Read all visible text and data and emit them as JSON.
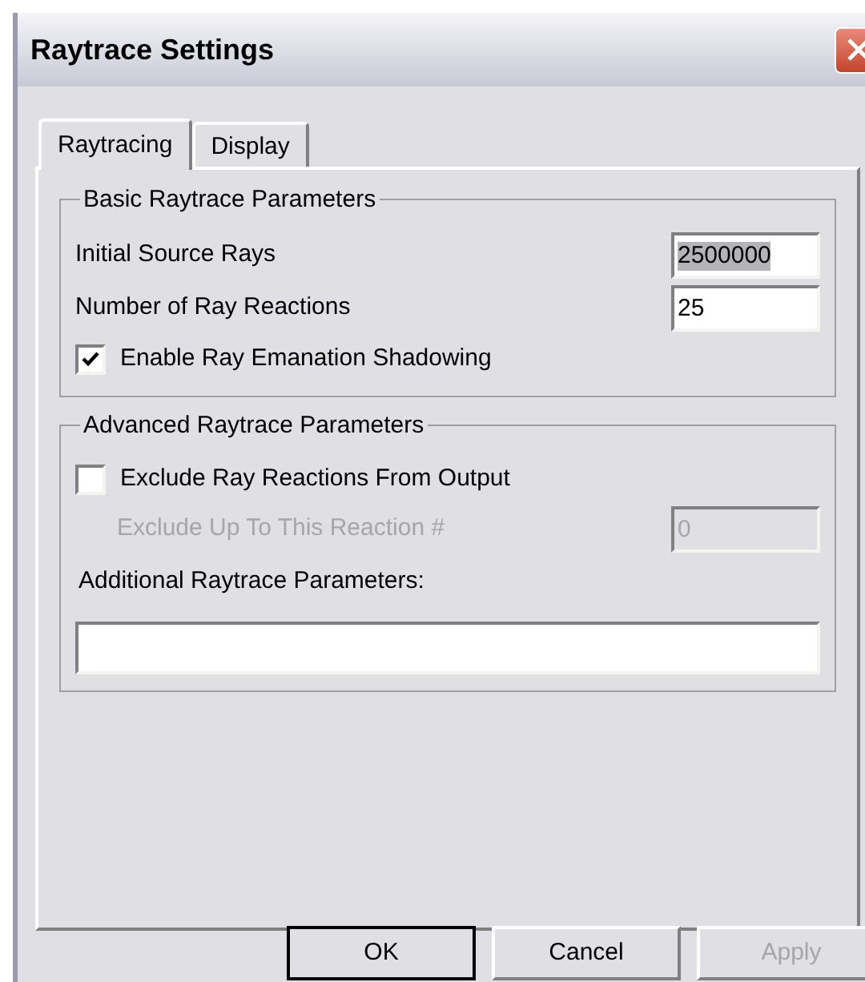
{
  "window": {
    "title": "Raytrace Settings"
  },
  "tabs": [
    {
      "label": "Raytracing",
      "selected": true
    },
    {
      "label": "Display",
      "selected": false
    }
  ],
  "groups": [
    {
      "title": "Basic Raytrace Parameters",
      "rows": [
        {
          "kind": "number",
          "label": "Initial Source Rays",
          "value": "2500000",
          "highlighted": true,
          "disabled": false
        },
        {
          "kind": "number",
          "label": "Number of Ray Reactions",
          "value": "25",
          "highlighted": false,
          "disabled": false
        },
        {
          "kind": "checkbox",
          "label": "Enable Ray Emanation Shadowing",
          "checked": true
        }
      ]
    },
    {
      "title": "Advanced Raytrace Parameters",
      "rows": [
        {
          "kind": "checkbox",
          "label": "Exclude Ray Reactions From Output",
          "checked": false
        },
        {
          "kind": "number",
          "label": "Exclude Up To This Reaction #",
          "value": "0",
          "highlighted": false,
          "disabled": true
        },
        {
          "kind": "text",
          "label": "Additional Raytrace Parameters:"
        }
      ]
    }
  ],
  "buttons": [
    {
      "label": "OK",
      "default": true,
      "disabled": false
    },
    {
      "label": "Cancel",
      "default": false,
      "disabled": false
    },
    {
      "label": "Apply",
      "default": false,
      "disabled": true
    }
  ]
}
